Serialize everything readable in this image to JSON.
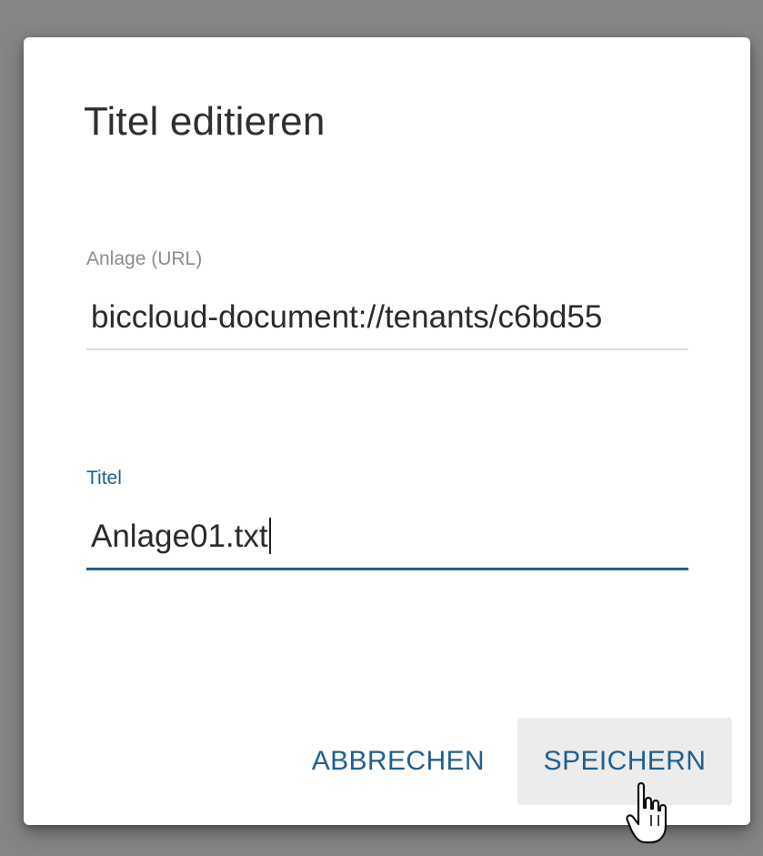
{
  "dialog": {
    "title": "Titel editieren",
    "url_field": {
      "label": "Anlage (URL)",
      "value": "biccloud-document://tenants/c6bd55"
    },
    "title_field": {
      "label": "Titel",
      "value": "Anlage01.txt"
    },
    "buttons": {
      "cancel": "ABBRECHEN",
      "save": "SPEICHERN"
    }
  },
  "colors": {
    "accent": "#1f5f93",
    "overlay": "#858585",
    "save_hover_bg": "#ececec"
  },
  "icons": {
    "cursor": "hand-pointer-icon"
  }
}
